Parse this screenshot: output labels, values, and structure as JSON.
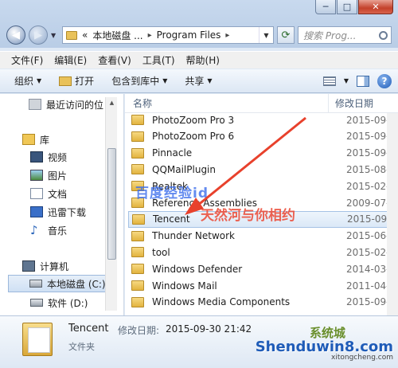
{
  "window": {
    "caption_minimize": "─",
    "caption_maximize": "□",
    "caption_close": "✕"
  },
  "address": {
    "prefix": "«",
    "crumbs": [
      "本地磁盘 ...",
      "Program Files"
    ],
    "separator": "▸",
    "search_placeholder": "搜索 Prog..."
  },
  "menu": [
    "文件(F)",
    "编辑(E)",
    "查看(V)",
    "工具(T)",
    "帮助(H)"
  ],
  "toolbar": {
    "organize": "组织",
    "open": "打开",
    "include_library": "包含到库中",
    "share": "共享"
  },
  "nav": {
    "recent": "最近访问的位",
    "library": "库",
    "video": "视频",
    "pictures": "图片",
    "documents": "文档",
    "thunder": "迅雷下载",
    "music": "音乐",
    "computer": "计算机",
    "local_disk": "本地磁盘 (C:)",
    "software": "软件 (D:)"
  },
  "columns": {
    "name": "名称",
    "date": "修改日期"
  },
  "files": [
    {
      "name": "PhotoZoom Pro 3",
      "date": "2015-09-"
    },
    {
      "name": "PhotoZoom Pro 6",
      "date": "2015-09-"
    },
    {
      "name": "Pinnacle",
      "date": "2015-09-"
    },
    {
      "name": "QQMailPlugin",
      "date": "2015-08-"
    },
    {
      "name": "Realtek",
      "date": "2015-02-"
    },
    {
      "name": "Reference Assemblies",
      "date": "2009-07-"
    },
    {
      "name": "Tencent",
      "date": "2015-09-"
    },
    {
      "name": "Thunder Network",
      "date": "2015-06-"
    },
    {
      "name": "tool",
      "date": "2015-02-"
    },
    {
      "name": "Windows Defender",
      "date": "2014-03-"
    },
    {
      "name": "Windows Mail",
      "date": "2011-04-"
    },
    {
      "name": "Windows Media Components",
      "date": "2015-09-"
    }
  ],
  "selected_index": 6,
  "details": {
    "name": "Tencent",
    "date_label": "修改日期:",
    "date_value": "2015-09-30 21:42",
    "type": "文件夹"
  },
  "watermarks": {
    "baidu": "百度经验id",
    "annotation": "天然河与你相约",
    "site_logo": "Shenduwin8.com",
    "site_url": "xitongcheng.com",
    "site_cn": "系统城"
  },
  "colors": {
    "annotation_arrow": "#e8412c",
    "baidu_text": "#3c6eeb",
    "selection": "#dbe8f7"
  }
}
